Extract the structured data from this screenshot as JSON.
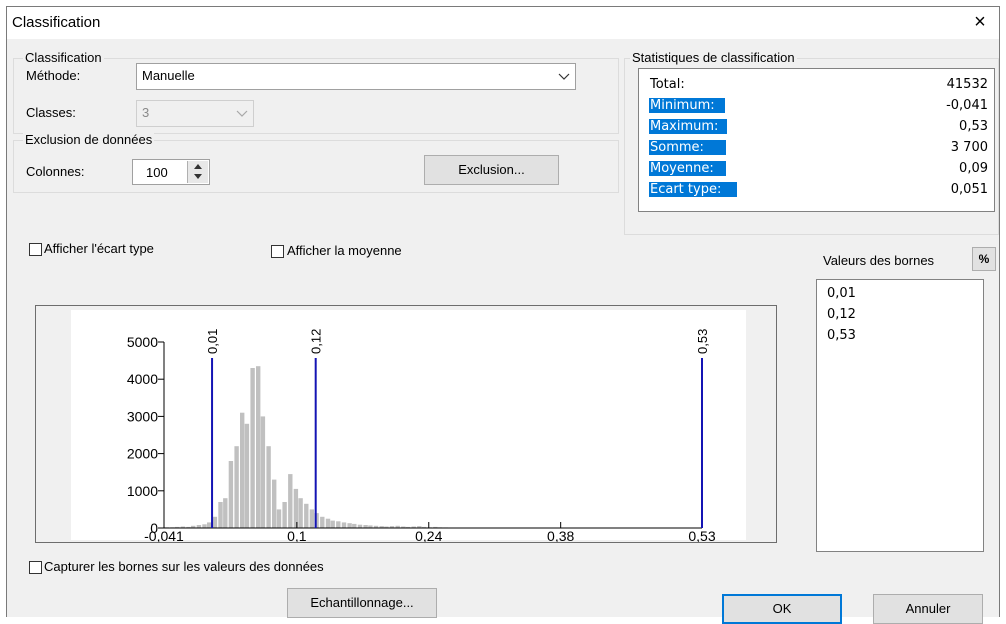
{
  "window": {
    "title": "Classification",
    "close_glyph": "×"
  },
  "classification": {
    "group_label": "Classification",
    "method_label": "Méthode:",
    "method_value": "Manuelle",
    "classes_label": "Classes:",
    "classes_value": "3"
  },
  "exclusion": {
    "group_label": "Exclusion de données",
    "columns_label": "Colonnes:",
    "columns_value": "100",
    "exclusion_button": "Exclusion..."
  },
  "stats": {
    "group_label": "Statistiques de classification",
    "rows": [
      {
        "key": "Total:",
        "value": "41532",
        "selected": false
      },
      {
        "key": "Minimum:",
        "value": "-0,041",
        "selected": true
      },
      {
        "key": "Maximum:",
        "value": "0,53",
        "selected": true
      },
      {
        "key": "Somme:",
        "value": "3 700",
        "selected": true
      },
      {
        "key": "Moyenne:",
        "value": "0,09",
        "selected": true
      },
      {
        "key": "Ecart type:",
        "value": "0,051",
        "selected": true
      }
    ]
  },
  "options": {
    "show_std_label": "Afficher l'écart type",
    "show_mean_label": "Afficher la moyenne",
    "snap_label": "Capturer les bornes sur les valeurs des données"
  },
  "bounds": {
    "label": "Valeurs des bornes",
    "percent_button": "%",
    "values": [
      "0,01",
      "0,12",
      "0,53"
    ]
  },
  "buttons": {
    "sampling": "Echantillonnage...",
    "ok": "OK",
    "cancel": "Annuler"
  },
  "chart_data": {
    "type": "bar",
    "title": "",
    "xlabel": "",
    "ylabel": "",
    "xlim": [
      -0.041,
      0.53
    ],
    "ylim": [
      0,
      5000
    ],
    "y_ticks": [
      0,
      1000,
      2000,
      3000,
      4000,
      5000
    ],
    "x_ticks": [
      -0.041,
      0.1,
      0.24,
      0.38,
      0.53
    ],
    "x_tick_labels": [
      "-0,041",
      "0,1",
      "0,24",
      "0,38",
      "0,53"
    ],
    "bin_width": 0.00571,
    "bins_x": [
      -0.038,
      -0.032,
      -0.027,
      -0.021,
      -0.015,
      -0.01,
      -0.004,
      0.002,
      0.007,
      0.013,
      0.019,
      0.024,
      0.03,
      0.036,
      0.042,
      0.047,
      0.053,
      0.059,
      0.064,
      0.07,
      0.076,
      0.081,
      0.087,
      0.093,
      0.099,
      0.104,
      0.11,
      0.116,
      0.121,
      0.127,
      0.133,
      0.138,
      0.144,
      0.15,
      0.156,
      0.161,
      0.167,
      0.173,
      0.178,
      0.184,
      0.19,
      0.195,
      0.201,
      0.207,
      0.213,
      0.218,
      0.224,
      0.23,
      0.235,
      0.241,
      0.247,
      0.252,
      0.258,
      0.264,
      0.27,
      0.275,
      0.281,
      0.287,
      0.292,
      0.298,
      0.304,
      0.309,
      0.315,
      0.321,
      0.327,
      0.332
    ],
    "values": [
      20,
      20,
      30,
      40,
      30,
      60,
      80,
      100,
      150,
      300,
      700,
      800,
      1800,
      2200,
      3100,
      2800,
      4300,
      4350,
      3000,
      2200,
      1300,
      500,
      700,
      1450,
      1050,
      800,
      650,
      500,
      400,
      300,
      250,
      200,
      180,
      150,
      130,
      110,
      90,
      80,
      70,
      60,
      50,
      40,
      50,
      60,
      40,
      30,
      40,
      50,
      30,
      20,
      30,
      20,
      15,
      10,
      12,
      8,
      10,
      6,
      8,
      5,
      5,
      4,
      3,
      3,
      2,
      2
    ],
    "class_breaks": [
      0.01,
      0.12,
      0.53
    ],
    "class_break_labels": [
      "0,01",
      "0,12",
      "0,53"
    ],
    "bar_color": "#c0c0c0",
    "break_color": "#1414b4"
  }
}
